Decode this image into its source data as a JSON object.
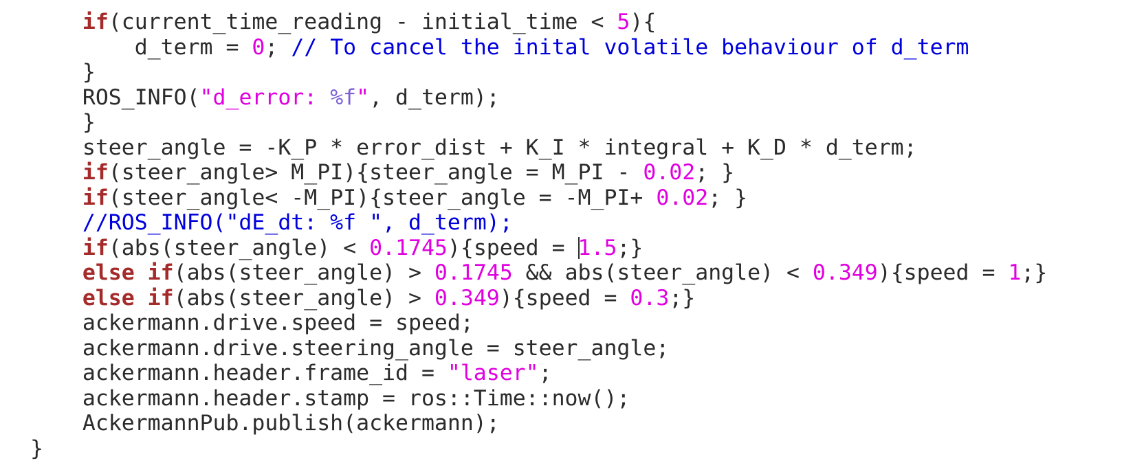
{
  "editor": {
    "lines": [
      [
        {
          "t": "    ",
          "c": "plain"
        },
        {
          "t": "if",
          "c": "kw"
        },
        {
          "t": "(current_time_reading - initial_time < ",
          "c": "plain"
        },
        {
          "t": "5",
          "c": "num"
        },
        {
          "t": "){",
          "c": "plain"
        }
      ],
      [
        {
          "t": "        d_term = ",
          "c": "plain"
        },
        {
          "t": "0",
          "c": "num"
        },
        {
          "t": "; ",
          "c": "plain"
        },
        {
          "t": "// To cancel the inital volatile behaviour of d_term",
          "c": "cmt"
        }
      ],
      [
        {
          "t": "    }",
          "c": "plain"
        }
      ],
      [
        {
          "t": "    ROS_INFO(",
          "c": "plain"
        },
        {
          "t": "\"d_error: ",
          "c": "str"
        },
        {
          "t": "%f",
          "c": "fmt"
        },
        {
          "t": "\"",
          "c": "str"
        },
        {
          "t": ", d_term);",
          "c": "plain"
        }
      ],
      [
        {
          "t": "    }",
          "c": "plain"
        }
      ],
      [
        {
          "t": "    steer_angle = -K_P * error_dist + K_I * integral + K_D * d_term;",
          "c": "plain"
        }
      ],
      [
        {
          "t": "    ",
          "c": "plain"
        },
        {
          "t": "if",
          "c": "kw"
        },
        {
          "t": "(steer_angle> M_PI){steer_angle = M_PI - ",
          "c": "plain"
        },
        {
          "t": "0.02",
          "c": "num"
        },
        {
          "t": "; }",
          "c": "plain"
        }
      ],
      [
        {
          "t": "    ",
          "c": "plain"
        },
        {
          "t": "if",
          "c": "kw"
        },
        {
          "t": "(steer_angle< -M_PI){steer_angle = -M_PI+ ",
          "c": "plain"
        },
        {
          "t": "0.02",
          "c": "num"
        },
        {
          "t": "; }",
          "c": "plain"
        }
      ],
      [
        {
          "t": "    ",
          "c": "plain"
        },
        {
          "t": "//ROS_INFO(\"dE_dt: %f \", d_term);",
          "c": "cmt"
        }
      ],
      [
        {
          "t": "    ",
          "c": "plain"
        },
        {
          "t": "if",
          "c": "kw"
        },
        {
          "t": "(abs(steer_angle) < ",
          "c": "plain"
        },
        {
          "t": "0.1745",
          "c": "num"
        },
        {
          "t": "){speed = ",
          "c": "plain"
        },
        {
          "t": "",
          "c": "caret"
        },
        {
          "t": "1.5",
          "c": "num"
        },
        {
          "t": ";}",
          "c": "plain"
        }
      ],
      [
        {
          "t": "    ",
          "c": "plain"
        },
        {
          "t": "else if",
          "c": "kw"
        },
        {
          "t": "(abs(steer_angle) > ",
          "c": "plain"
        },
        {
          "t": "0.1745",
          "c": "num"
        },
        {
          "t": " && abs(steer_angle) < ",
          "c": "plain"
        },
        {
          "t": "0.349",
          "c": "num"
        },
        {
          "t": "){speed = ",
          "c": "plain"
        },
        {
          "t": "1",
          "c": "num"
        },
        {
          "t": ";}",
          "c": "plain"
        }
      ],
      [
        {
          "t": "    ",
          "c": "plain"
        },
        {
          "t": "else if",
          "c": "kw"
        },
        {
          "t": "(abs(steer_angle) > ",
          "c": "plain"
        },
        {
          "t": "0.349",
          "c": "num"
        },
        {
          "t": "){speed = ",
          "c": "plain"
        },
        {
          "t": "0.3",
          "c": "num"
        },
        {
          "t": ";}",
          "c": "plain"
        }
      ],
      [
        {
          "t": "    ackermann.drive.speed = speed;",
          "c": "plain"
        }
      ],
      [
        {
          "t": "    ackermann.drive.steering_angle = steer_angle;",
          "c": "plain"
        }
      ],
      [
        {
          "t": "    ackermann.header.frame_id = ",
          "c": "plain"
        },
        {
          "t": "\"laser\"",
          "c": "str"
        },
        {
          "t": ";",
          "c": "plain"
        }
      ],
      [
        {
          "t": "    ackermann.header.stamp = ros::Time::now();",
          "c": "plain"
        }
      ],
      [
        {
          "t": "    AckermannPub.publish(ackermann);",
          "c": "plain"
        }
      ],
      [
        {
          "t": "}",
          "c": "plain"
        }
      ]
    ]
  },
  "colors": {
    "keyword": "#a52a2a",
    "number": "#e000e0",
    "string": "#e000e0",
    "format_specifier": "#7b5fd6",
    "comment": "#0000dd",
    "plain": "#2b2b2b",
    "background": "#ffffff"
  }
}
